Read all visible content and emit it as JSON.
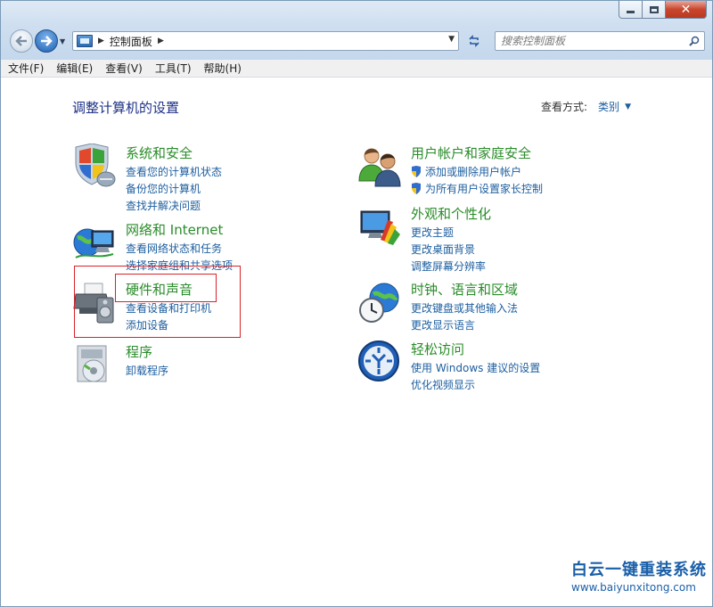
{
  "window": {
    "min_label": "",
    "max_label": "",
    "close_label": "✕"
  },
  "address": {
    "path": "控制面板"
  },
  "search": {
    "placeholder": "搜索控制面板"
  },
  "menu": {
    "items": [
      {
        "label": "文件(F)"
      },
      {
        "label": "编辑(E)"
      },
      {
        "label": "查看(V)"
      },
      {
        "label": "工具(T)"
      },
      {
        "label": "帮助(H)"
      }
    ]
  },
  "page": {
    "title": "调整计算机的设置",
    "view_by_label": "查看方式:",
    "view_by_value": "类别"
  },
  "categories": [
    {
      "title": "系统和安全",
      "icon": "shield-computer-icon",
      "links": [
        "查看您的计算机状态",
        "备份您的计算机",
        "查找并解决问题"
      ]
    },
    {
      "title": "网络和 Internet",
      "icon": "network-globe-icon",
      "links": [
        "查看网络状态和任务",
        "选择家庭组和共享选项"
      ]
    },
    {
      "title": "硬件和声音",
      "icon": "printer-speaker-icon",
      "links": [
        "查看设备和打印机",
        "添加设备"
      ]
    },
    {
      "title": "程序",
      "icon": "programs-disc-icon",
      "links": [
        "卸载程序"
      ]
    },
    {
      "title": "用户帐户和家庭安全",
      "icon": "users-icon",
      "links": [
        "添加或删除用户帐户",
        "为所有用户设置家长控制"
      ]
    },
    {
      "title": "外观和个性化",
      "icon": "display-palette-icon",
      "links": [
        "更改主题",
        "更改桌面背景",
        "调整屏幕分辨率"
      ]
    },
    {
      "title": "时钟、语言和区域",
      "icon": "clock-globe-icon",
      "links": [
        "更改键盘或其他输入法",
        "更改显示语言"
      ]
    },
    {
      "title": "轻松访问",
      "icon": "ease-of-access-icon",
      "links": [
        "使用 Windows 建议的设置",
        "优化视频显示"
      ]
    }
  ],
  "watermark": {
    "title": "白云一键重装系统",
    "url": "www.baiyunxitong.com"
  },
  "colors": {
    "accent_link": "#1e5fa0",
    "category_title": "#2a8c2a",
    "page_title": "#1e3287",
    "highlight_box": "#d8232a"
  }
}
